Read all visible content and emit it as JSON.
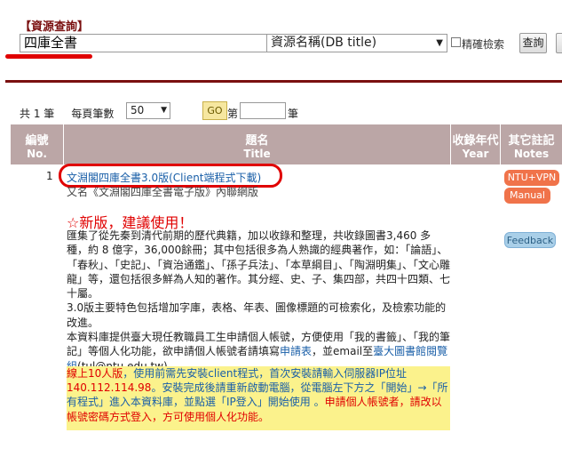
{
  "search": {
    "title": "【資源查詢】",
    "query": "四庫全書",
    "field": "資源名稱(DB title)",
    "exact_label": "精確檢索",
    "button": "查詢"
  },
  "results": {
    "count_text": "共 1 筆",
    "per_page_label": "每頁筆數",
    "per_page_value": "50",
    "go_label": "GO",
    "page_prefix": "第",
    "page_suffix": "筆",
    "columns": {
      "no": [
        "編號",
        "No."
      ],
      "title": [
        "題名",
        "Title"
      ],
      "year": [
        "收錄年代",
        "Year"
      ],
      "notes": [
        "其它註記",
        "Notes"
      ]
    },
    "row": {
      "no": "1",
      "title": "文淵閣四庫全書3.0版(Client端程式下載)",
      "subtitle": "又名《文淵閣四庫全書電子版》內聯網版",
      "new_heading": "☆新版，建議使用！",
      "desc_1": "匯集了從先秦到清代前期的歷代典籍，加以收錄和整理，共收錄圖書3,460 多種，約 8 億字，36,000餘冊；其中包括很多為人熟識的經典著作，如：「論語」、「春秋」、「史記」、「資治通鑑」、「孫子兵法」、「本草綱目」、「陶淵明集」、「文心雕龍」等，還包括很多鮮為人知的著作。其分經、史、子、集四部，共四十四類、七十屬。",
      "desc_2": "3.0版主要特色包括增加字庫，表格、年表、圖像標題的可檢索化，及檢索功能的改進。",
      "desc_3a": "本資料庫提供臺大現任教職員工生申請個人帳號，方便使用「我的書籤」、「我的筆記」等個人化功能，欲申請個人帳號者請填寫",
      "desc_3_link": "申請表",
      "desc_3b": "，並email至",
      "desc_3_link2": "臺大圖書館閱覽組",
      "desc_3c": "(tul@ntu.edu.tw)。",
      "notice_1": "線上10人版",
      "notice_2": "，使用前需先安裝client程式，首次安裝請輸入伺服器IP位址",
      "notice_ip": "140.112.114.98",
      "notice_3": "。安裝完成後請重新啟動電腦，從電腦左下方之「開始」→「所有程式」進入本資料庫，並點選「IP登入」開始使用 。",
      "notice_4": "申請個人帳號者，請改以帳號密碼方式登入，方可使用個人化功能。",
      "badge_vpn": "NTU+VPN",
      "badge_manual": "Manual",
      "badge_feedback": "Feedback"
    }
  }
}
